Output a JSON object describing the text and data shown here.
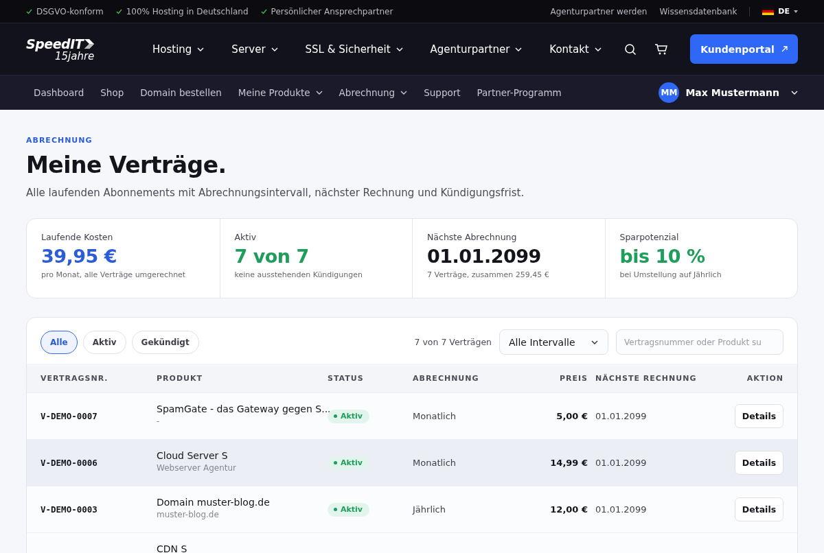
{
  "topbar": {
    "badges": [
      "DSGVO-konform",
      "100% Hosting in Deutschland",
      "Persönlicher Ansprechpartner"
    ],
    "links": [
      "Agenturpartner werden",
      "Wissensdatenbank"
    ],
    "language": "DE"
  },
  "header": {
    "logo": {
      "brand": "SpeedIT",
      "tagline": "15jahre"
    },
    "nav": [
      "Hosting",
      "Server",
      "SSL & Sicherheit",
      "Agenturpartner",
      "Kontakt"
    ],
    "cta": "Kundenportal"
  },
  "subnav": {
    "items": [
      {
        "label": "Dashboard",
        "dropdown": false
      },
      {
        "label": "Shop",
        "dropdown": false
      },
      {
        "label": "Domain bestellen",
        "dropdown": false
      },
      {
        "label": "Meine Produkte",
        "dropdown": true
      },
      {
        "label": "Abrechnung",
        "dropdown": true
      },
      {
        "label": "Support",
        "dropdown": false
      },
      {
        "label": "Partner-Programm",
        "dropdown": false
      }
    ],
    "user": {
      "initials": "MM",
      "name": "Max Mustermann"
    }
  },
  "page": {
    "kicker": "ABRECHNUNG",
    "title": "Meine Verträge.",
    "subtitle": "Alle laufenden Abonnements mit Abrechnungsintervall, nächster Rechnung und Kündigungsfrist."
  },
  "stats": [
    {
      "label": "Laufende Kosten",
      "value": "39,95 €",
      "note": "pro Monat, alle Verträge umgerechnet",
      "color": "#2b5cd9"
    },
    {
      "label": "Aktiv",
      "value": "7 von 7",
      "note": "keine ausstehenden Kündigungen",
      "color": "#1e9e5a"
    },
    {
      "label": "Nächste Abrechnung",
      "value": "01.01.2099",
      "note": "7 Verträge, zusammen 259,45 €",
      "color": "#14151c"
    },
    {
      "label": "Sparpotenzial",
      "value": "bis 10 %",
      "note": "bei Umstellung auf Jährlich",
      "color": "#1e9e5a"
    }
  ],
  "filters": {
    "tabs": [
      {
        "label": "Alle",
        "selected": true
      },
      {
        "label": "Aktiv",
        "selected": false
      },
      {
        "label": "Gekündigt",
        "selected": false
      }
    ],
    "count": "7 von 7 Verträgen",
    "interval": "Alle Intervalle",
    "search_placeholder": "Vertragsnummer oder Produkt su"
  },
  "table": {
    "columns": [
      "VERTRAGSNR.",
      "PRODUKT",
      "STATUS",
      "ABRECHNUNG",
      "PREIS",
      "NÄCHSTE RECHNUNG",
      "AKTION"
    ],
    "rows": [
      {
        "id": "V-DEMO-0007",
        "product": "SpamGate - das Gateway gegen S...",
        "detail": "-",
        "status": "Aktiv",
        "billing": "Monatlich",
        "price": "5,00 €",
        "next": "01.01.2099",
        "action": "Details",
        "selected": false
      },
      {
        "id": "V-DEMO-0006",
        "product": "Cloud Server S",
        "detail": "Webserver Agentur",
        "status": "Aktiv",
        "billing": "Monatlich",
        "price": "14,99 €",
        "next": "01.01.2099",
        "action": "Details",
        "selected": true
      },
      {
        "id": "V-DEMO-0003",
        "product": "Domain muster-blog.de",
        "detail": "muster-blog.de",
        "status": "Aktiv",
        "billing": "Jährlich",
        "price": "12,00 €",
        "next": "01.01.2099",
        "action": "Details",
        "selected": false
      },
      {
        "product": "CDN S",
        "selected": false
      }
    ]
  }
}
